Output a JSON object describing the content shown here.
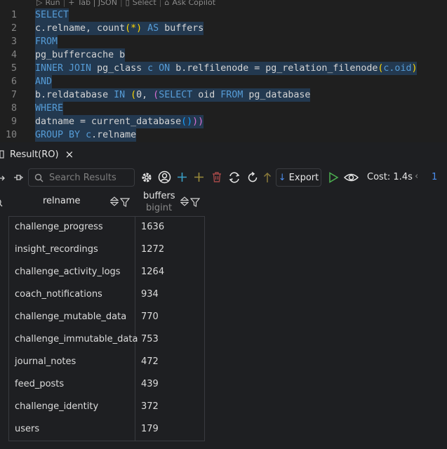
{
  "codelens": {
    "run": "Run",
    "tab_json": "Tab | JSON",
    "select": "Select",
    "ask_copilot": "Ask Copilot"
  },
  "editor": {
    "lines": [
      {
        "n": "1"
      },
      {
        "n": "2"
      },
      {
        "n": "3"
      },
      {
        "n": "4"
      },
      {
        "n": "5"
      },
      {
        "n": "6"
      },
      {
        "n": "7"
      },
      {
        "n": "8"
      },
      {
        "n": "9"
      },
      {
        "n": "10"
      }
    ],
    "tokens": {
      "l1": "SELECT",
      "l2a": "c.relname, count",
      "l2b": "(",
      "l2c": "*",
      "l2d": ")",
      "l2e": "AS",
      "l2f": "buffers",
      "l3": "FROM",
      "l4": "pg_buffercache b",
      "l5a": "INNER JOIN",
      "l5b": "pg_class",
      "l5c": "c",
      "l5d": "ON",
      "l5e": "b.relfilenode = pg_relation_filenode",
      "l5f": "(",
      "l5g": "c.oid",
      "l5h": ")",
      "l6": "AND",
      "l7a": "b.reldatabase",
      "l7b": "IN",
      "l7c": "(",
      "l7d": "0, ",
      "l7e": "(",
      "l7f": "SELECT",
      "l7g": "oid",
      "l7h": "FROM",
      "l7i": "pg_database",
      "l8": "WHERE",
      "l9a": "datname = current_database",
      "l9b": "()",
      "l9c": "))",
      "l10a": "GROUP BY",
      "l10b": "c",
      "l10c": ".relname"
    }
  },
  "result_tab": {
    "label": "Result(RO)",
    "close": "×"
  },
  "toolbar": {
    "search_placeholder": "Search Results",
    "export_label": "Export",
    "cost": "Cost: 1.4s",
    "page": "1",
    "prev": "‹"
  },
  "grid": {
    "columns": [
      {
        "name": "relname",
        "type": ""
      },
      {
        "name": "buffers",
        "type": "bigint"
      }
    ],
    "rows": [
      {
        "relname": "challenge_progress",
        "buffers": "1636"
      },
      {
        "relname": "insight_recordings",
        "buffers": "1272"
      },
      {
        "relname": "challenge_activity_logs",
        "buffers": "1264"
      },
      {
        "relname": "coach_notifications",
        "buffers": "934"
      },
      {
        "relname": "challenge_mutable_data",
        "buffers": "770"
      },
      {
        "relname": "challenge_immutable_data",
        "buffers": "753"
      },
      {
        "relname": "journal_notes",
        "buffers": "472"
      },
      {
        "relname": "feed_posts",
        "buffers": "439"
      },
      {
        "relname": "challenge_identity",
        "buffers": "372"
      },
      {
        "relname": "users",
        "buffers": "179"
      }
    ]
  },
  "colors": {
    "accent": "#3574f0",
    "keyword": "#569cd6",
    "run_green": "#4caf50"
  }
}
